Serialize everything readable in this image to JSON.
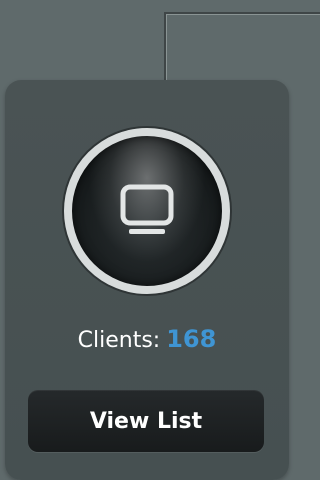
{
  "clients_panel": {
    "label": "Clients:",
    "count": "168",
    "count_color": "#3f95d4",
    "device_icon": "monitor-icon",
    "view_list_label": "View List"
  }
}
